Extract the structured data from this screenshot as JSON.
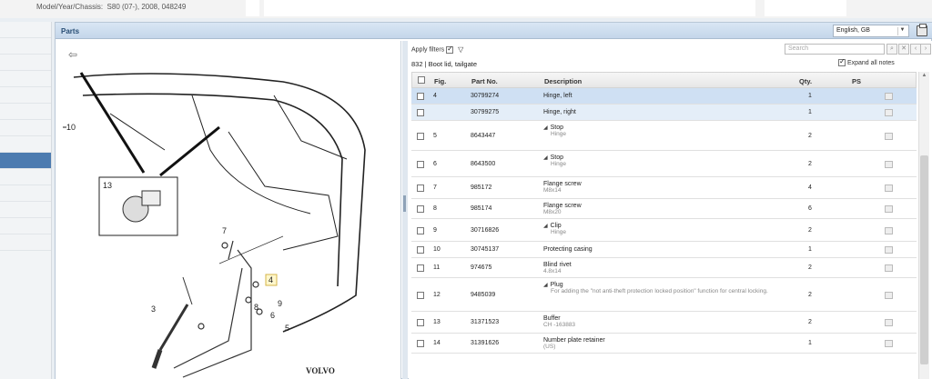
{
  "header": {
    "model_label": "Model/Year/Chassis:",
    "model_value": "S80 (07-), 2008, 048249"
  },
  "panel": {
    "title": "Parts",
    "language": "English, GB"
  },
  "filters": {
    "apply_label": "Apply filters",
    "search_placeholder": "Search",
    "expand_label": "Expand all notes"
  },
  "group": {
    "title": "832  |  Boot lid, tailgate"
  },
  "columns": {
    "fig": "Fig.",
    "part": "Part No.",
    "desc": "Description",
    "qty": "Qty.",
    "ps": "PS"
  },
  "rows": [
    {
      "fig": "4",
      "part": "30799274",
      "desc": "Hinge, left",
      "sub": "",
      "qty": "1",
      "selected": "primary"
    },
    {
      "fig": "",
      "part": "30799275",
      "desc": "Hinge, right",
      "sub": "",
      "qty": "1",
      "selected": "secondary"
    },
    {
      "fig": "5",
      "part": "8643447",
      "desc": "Stop",
      "sub": "Hinge",
      "qty": "2",
      "tri": "true"
    },
    {
      "fig": "6",
      "part": "8643500",
      "desc": "Stop",
      "sub": "Hinge",
      "qty": "2",
      "tri": "true"
    },
    {
      "fig": "7",
      "part": "985172",
      "desc": "Flange screw",
      "sub": "M8x14",
      "qty": "4"
    },
    {
      "fig": "8",
      "part": "985174",
      "desc": "Flange screw",
      "sub": "M8x20",
      "qty": "6"
    },
    {
      "fig": "9",
      "part": "30716826",
      "desc": "Clip",
      "sub": "Hinge",
      "qty": "2",
      "tri": "true"
    },
    {
      "fig": "10",
      "part": "30745137",
      "desc": "Protecting casing",
      "sub": "",
      "qty": "1"
    },
    {
      "fig": "11",
      "part": "974675",
      "desc": "Blind rivet",
      "sub": "4.8x14",
      "qty": "2"
    },
    {
      "fig": "12",
      "part": "9485039",
      "desc": "Plug",
      "sub": "For adding the \"not anti-theft protection locked position\" function for central locking.",
      "qty": "2",
      "tri": "true"
    },
    {
      "fig": "13",
      "part": "31371523",
      "desc": "Buffer",
      "sub": "CH -163883",
      "qty": "2"
    },
    {
      "fig": "14",
      "part": "31391626",
      "desc": "Number plate retainer",
      "sub": "(US)",
      "qty": "1"
    }
  ],
  "diagram": {
    "callouts": [
      "10",
      "13",
      "7",
      "4",
      "3",
      "9",
      "8",
      "6",
      "5"
    ],
    "brand": "VOLVO"
  }
}
